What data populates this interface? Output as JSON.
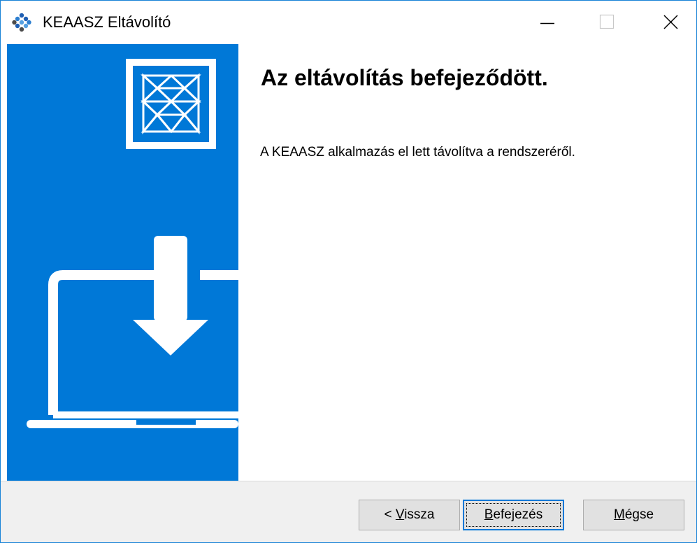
{
  "window": {
    "title": "KEAASZ Eltávolító",
    "app_icon": "keaasz-logo-icon",
    "controls": {
      "minimize_icon": "minimize-icon",
      "maximize_icon": "maximize-icon",
      "close_icon": "close-icon"
    }
  },
  "banner": {
    "logo_icon": "keaasz-triangle-logo-icon",
    "illustration_icon": "laptop-download-icon",
    "background_color": "#0078d7"
  },
  "main": {
    "heading": "Az eltávolítás befejeződött.",
    "message": "A KEAASZ alkalmazás el lett távolítva a rendszeréről."
  },
  "footer": {
    "back_label_prefix": "< ",
    "back_label_mnemonic": "V",
    "back_label_rest": "issza",
    "finish_label_mnemonic": "B",
    "finish_label_rest": "efejezés",
    "cancel_label_prefix": "",
    "cancel_label_mnemonic": "M",
    "cancel_label_rest": "égse"
  }
}
